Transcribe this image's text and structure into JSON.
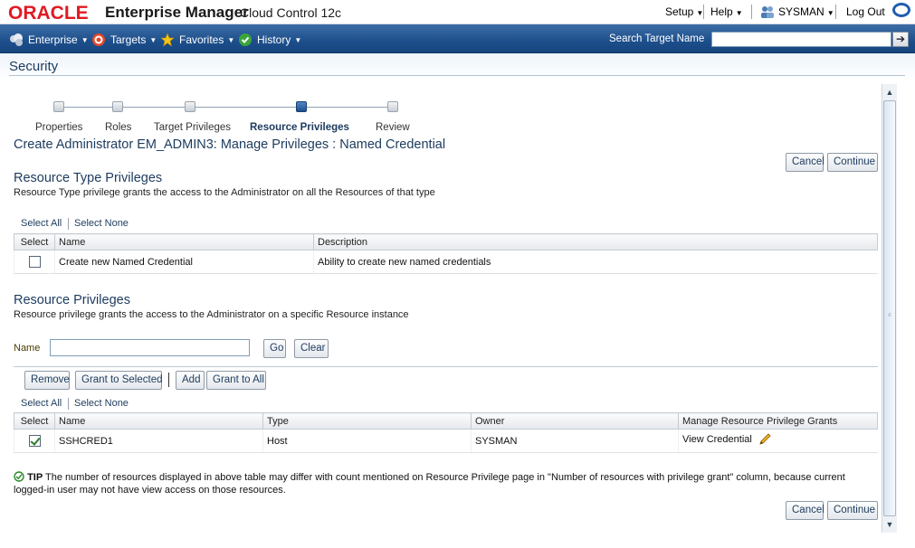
{
  "brand": {
    "oracle": "ORACLE",
    "product": "Enterprise Manager",
    "edition": "Cloud Control 12c"
  },
  "global_nav": {
    "setup": "Setup",
    "help": "Help",
    "user": "SYSMAN",
    "logout": "Log Out"
  },
  "menu": {
    "enterprise": "Enterprise",
    "targets": "Targets",
    "favorites": "Favorites",
    "history": "History",
    "search_label": "Search Target Name",
    "search_value": ""
  },
  "page": {
    "title": "Security"
  },
  "train": {
    "steps": [
      "Properties",
      "Roles",
      "Target Privileges",
      "Resource Privileges",
      "Review"
    ],
    "current_index": 3
  },
  "main": {
    "heading": "Create Administrator EM_ADMIN3: Manage Privileges : Named Credential",
    "cancel": "Cancel",
    "continue": "Continue"
  },
  "resource_type": {
    "heading": "Resource Type Privileges",
    "description": "Resource Type privilege grants the access to the Administrator on all the Resources of that type",
    "select_all": "Select All",
    "select_none": "Select None",
    "columns": [
      "Select",
      "Name",
      "Description"
    ],
    "rows": [
      {
        "checked": false,
        "name": "Create new Named Credential",
        "description": "Ability to create new named credentials"
      }
    ]
  },
  "resource": {
    "heading": "Resource Privileges",
    "description": "Resource privilege grants the access to the Administrator on a specific Resource instance",
    "name_label": "Name",
    "name_value": "",
    "go": "Go",
    "clear": "Clear",
    "remove": "Remove",
    "grant_selected": "Grant to Selected",
    "add": "Add",
    "grant_all": "Grant to All",
    "select_all": "Select All",
    "select_none": "Select None",
    "columns": [
      "Select",
      "Name",
      "Type",
      "Owner",
      "Manage Resource Privilege Grants"
    ],
    "rows": [
      {
        "checked": true,
        "name": "SSHCRED1",
        "type": "Host",
        "owner": "SYSMAN",
        "grants": "View Credential"
      }
    ]
  },
  "tip": {
    "label": "TIP",
    "text": "The number of resources displayed in above table may differ with count mentioned on Resource Privilege page in \"Number of resources with privilege grant\" column, because current logged-in user may not have view access on those resources."
  },
  "colors": {
    "menubar": "#1d4f8c",
    "heading": "#1c3b5e",
    "oracle_red": "#e01a22"
  }
}
